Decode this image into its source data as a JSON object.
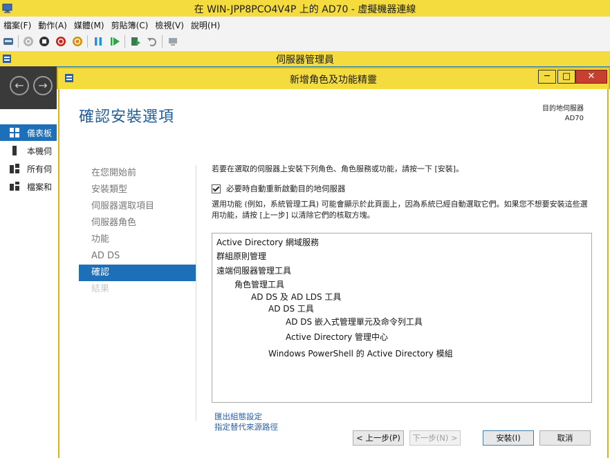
{
  "vm": {
    "title": "在 WIN-JPP8PCO4V4P 上的 AD70 - 虛擬機器連線",
    "menu": [
      "檔案(F)",
      "動作(A)",
      "媒體(M)",
      "剪貼簿(C)",
      "檢視(V)",
      "說明(H)"
    ]
  },
  "server_manager": {
    "title": "伺服器管理員",
    "sidebar": [
      {
        "label": "儀表板",
        "icon": "dashboard-icon"
      },
      {
        "label": "本機伺",
        "icon": "local-server-icon"
      },
      {
        "label": "所有伺",
        "icon": "all-servers-icon"
      },
      {
        "label": "檔案和",
        "icon": "file-storage-icon"
      }
    ]
  },
  "wizard": {
    "title": "新增角色及功能精靈",
    "page_title": "確認安裝選項",
    "destination_label": "目的地伺服器",
    "destination_value": "AD70",
    "steps": [
      {
        "label": "在您開始前",
        "state": "normal"
      },
      {
        "label": "安裝類型",
        "state": "normal"
      },
      {
        "label": "伺服器選取項目",
        "state": "normal"
      },
      {
        "label": "伺服器角色",
        "state": "normal"
      },
      {
        "label": "功能",
        "state": "normal"
      },
      {
        "label": "AD DS",
        "state": "normal"
      },
      {
        "label": "確認",
        "state": "active"
      },
      {
        "label": "結果",
        "state": "disabled"
      }
    ],
    "intro": "若要在選取的伺服器上安裝下列角色、角色服務或功能，請按一下 [安裝]。",
    "restart_checkbox_label": "必要時自動重新啟動目的地伺服器",
    "restart_checked": true,
    "note": "選用功能 (例如，系統管理工具) 可能會顯示於此頁面上，因為系統已經自動選取它們。如果您不想要安裝這些選用功能，請按 [上一步] 以清除它們的核取方塊。",
    "items": [
      {
        "text": "Active Directory 網域服務",
        "level": 0
      },
      {
        "text": "群組原則管理",
        "level": 0
      },
      {
        "text": "遠端伺服器管理工具",
        "level": 0
      },
      {
        "text": "角色管理工具",
        "level": 1
      },
      {
        "text": "AD DS 及 AD LDS 工具",
        "level": 2
      },
      {
        "text": "AD DS 工具",
        "level": 3
      },
      {
        "text": "AD DS 嵌入式管理單元及命令列工具",
        "level": 4
      },
      {
        "text": "Active Directory 管理中心",
        "level": 4
      },
      {
        "text": "Windows PowerShell 的 Active Directory 模組",
        "level": 3
      }
    ],
    "links": {
      "export": "匯出組態設定",
      "alt_source": "指定替代來源路徑"
    },
    "buttons": {
      "previous": "< 上一步(P)",
      "next": "下一步(N) >",
      "install": "安裝(I)",
      "cancel": "取消"
    }
  }
}
